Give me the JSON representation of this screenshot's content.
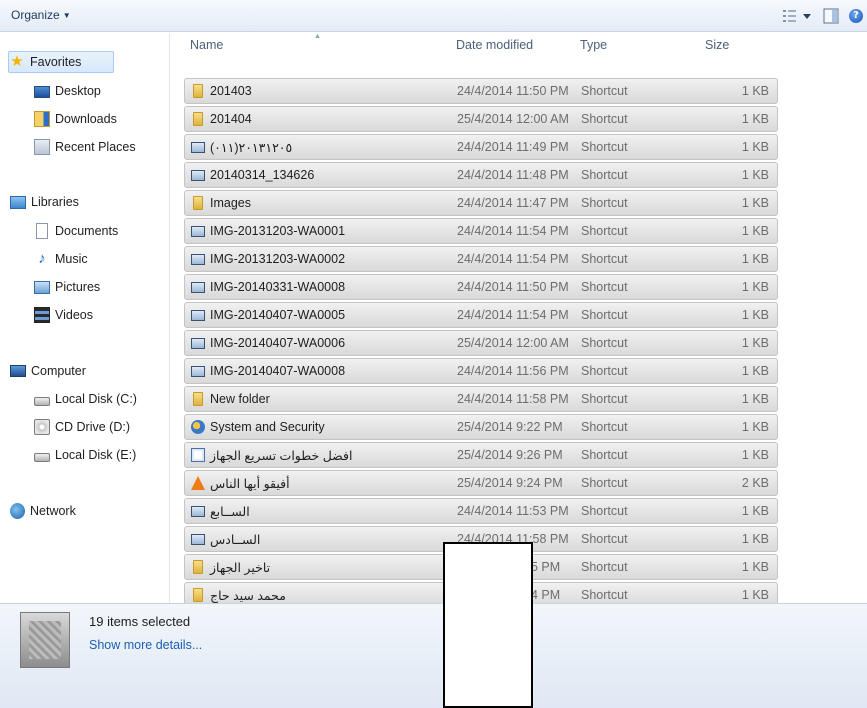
{
  "toolbar": {
    "organize_label": "Organize",
    "organize_icon": "chevron-down-icon",
    "views_icon": "view-list-icon",
    "preview_icon": "preview-pane-icon",
    "help_label": "?",
    "help_icon": "help-icon"
  },
  "nav": {
    "favorites": {
      "label": "Favorites",
      "icon": "star-icon"
    },
    "desktop": {
      "label": "Desktop",
      "icon": "desktop-icon"
    },
    "downloads": {
      "label": "Downloads",
      "icon": "downloads-icon"
    },
    "recent": {
      "label": "Recent Places",
      "icon": "recent-places-icon"
    },
    "libraries": {
      "label": "Libraries",
      "icon": "libraries-icon"
    },
    "documents": {
      "label": "Documents",
      "icon": "documents-icon"
    },
    "music": {
      "label": "Music",
      "icon": "music-icon"
    },
    "pictures": {
      "label": "Pictures",
      "icon": "pictures-icon"
    },
    "videos": {
      "label": "Videos",
      "icon": "videos-icon"
    },
    "computer": {
      "label": "Computer",
      "icon": "computer-icon"
    },
    "disk_c": {
      "label": "Local Disk (C:)",
      "icon": "disk-icon"
    },
    "cd_d": {
      "label": "CD Drive (D:)",
      "icon": "cd-drive-icon"
    },
    "disk_e": {
      "label": "Local Disk (E:)",
      "icon": "disk-icon"
    },
    "network": {
      "label": "Network",
      "icon": "network-icon"
    }
  },
  "columns": {
    "name": "Name",
    "date": "Date modified",
    "type": "Type",
    "size": "Size"
  },
  "rows": [
    {
      "name": "201403",
      "date": "24/4/2014 11:50 PM",
      "type": "Shortcut",
      "size": "1 KB",
      "icon": "folder-icon"
    },
    {
      "name": "201404",
      "date": "25/4/2014 12:00 AM",
      "type": "Shortcut",
      "size": "1 KB",
      "icon": "folder-icon"
    },
    {
      "name": "٢٠١٣١٢٠٥(٠١١)",
      "date": "24/4/2014 11:49 PM",
      "type": "Shortcut",
      "size": "1 KB",
      "icon": "shortcut-icon"
    },
    {
      "name": "20140314_134626",
      "date": "24/4/2014 11:48 PM",
      "type": "Shortcut",
      "size": "1 KB",
      "icon": "shortcut-icon"
    },
    {
      "name": "Images",
      "date": "24/4/2014 11:47 PM",
      "type": "Shortcut",
      "size": "1 KB",
      "icon": "folder-icon"
    },
    {
      "name": "IMG-20131203-WA0001",
      "date": "24/4/2014 11:54 PM",
      "type": "Shortcut",
      "size": "1 KB",
      "icon": "shortcut-icon"
    },
    {
      "name": "IMG-20131203-WA0002",
      "date": "24/4/2014 11:54 PM",
      "type": "Shortcut",
      "size": "1 KB",
      "icon": "shortcut-icon"
    },
    {
      "name": "IMG-20140331-WA0008",
      "date": "24/4/2014 11:50 PM",
      "type": "Shortcut",
      "size": "1 KB",
      "icon": "shortcut-icon"
    },
    {
      "name": "IMG-20140407-WA0005",
      "date": "24/4/2014 11:54 PM",
      "type": "Shortcut",
      "size": "1 KB",
      "icon": "shortcut-icon"
    },
    {
      "name": "IMG-20140407-WA0006",
      "date": "25/4/2014 12:00 AM",
      "type": "Shortcut",
      "size": "1 KB",
      "icon": "shortcut-icon"
    },
    {
      "name": "IMG-20140407-WA0008",
      "date": "24/4/2014 11:56 PM",
      "type": "Shortcut",
      "size": "1 KB",
      "icon": "shortcut-icon"
    },
    {
      "name": "New folder",
      "date": "24/4/2014 11:58 PM",
      "type": "Shortcut",
      "size": "1 KB",
      "icon": "folder-icon"
    },
    {
      "name": "System and Security",
      "date": "25/4/2014 9:22 PM",
      "type": "Shortcut",
      "size": "1 KB",
      "icon": "control-panel-icon"
    },
    {
      "name": "افضل خطوات تسريع الجهاز",
      "date": "25/4/2014 9:26 PM",
      "type": "Shortcut",
      "size": "1 KB",
      "icon": "word-document-icon"
    },
    {
      "name": "أفيقو أيها الناس",
      "date": "25/4/2014 9:24 PM",
      "type": "Shortcut",
      "size": "2 KB",
      "icon": "vlc-icon"
    },
    {
      "name": "الســابع",
      "date": "24/4/2014 11:53 PM",
      "type": "Shortcut",
      "size": "1 KB",
      "icon": "shortcut-icon"
    },
    {
      "name": "الســادس",
      "date": "24/4/2014 11:58 PM",
      "type": "Shortcut",
      "size": "1 KB",
      "icon": "shortcut-icon"
    },
    {
      "name": "تاخير الجهاز",
      "date": "5 PM",
      "type": "Shortcut",
      "size": "1 KB",
      "icon": "folder-icon"
    },
    {
      "name": "محمد سيد حاج",
      "date": "4 PM",
      "type": "Shortcut",
      "size": "1 KB",
      "icon": "folder-icon"
    }
  ],
  "details": {
    "selection_text": "19 items selected",
    "more_link": "Show more details..."
  }
}
